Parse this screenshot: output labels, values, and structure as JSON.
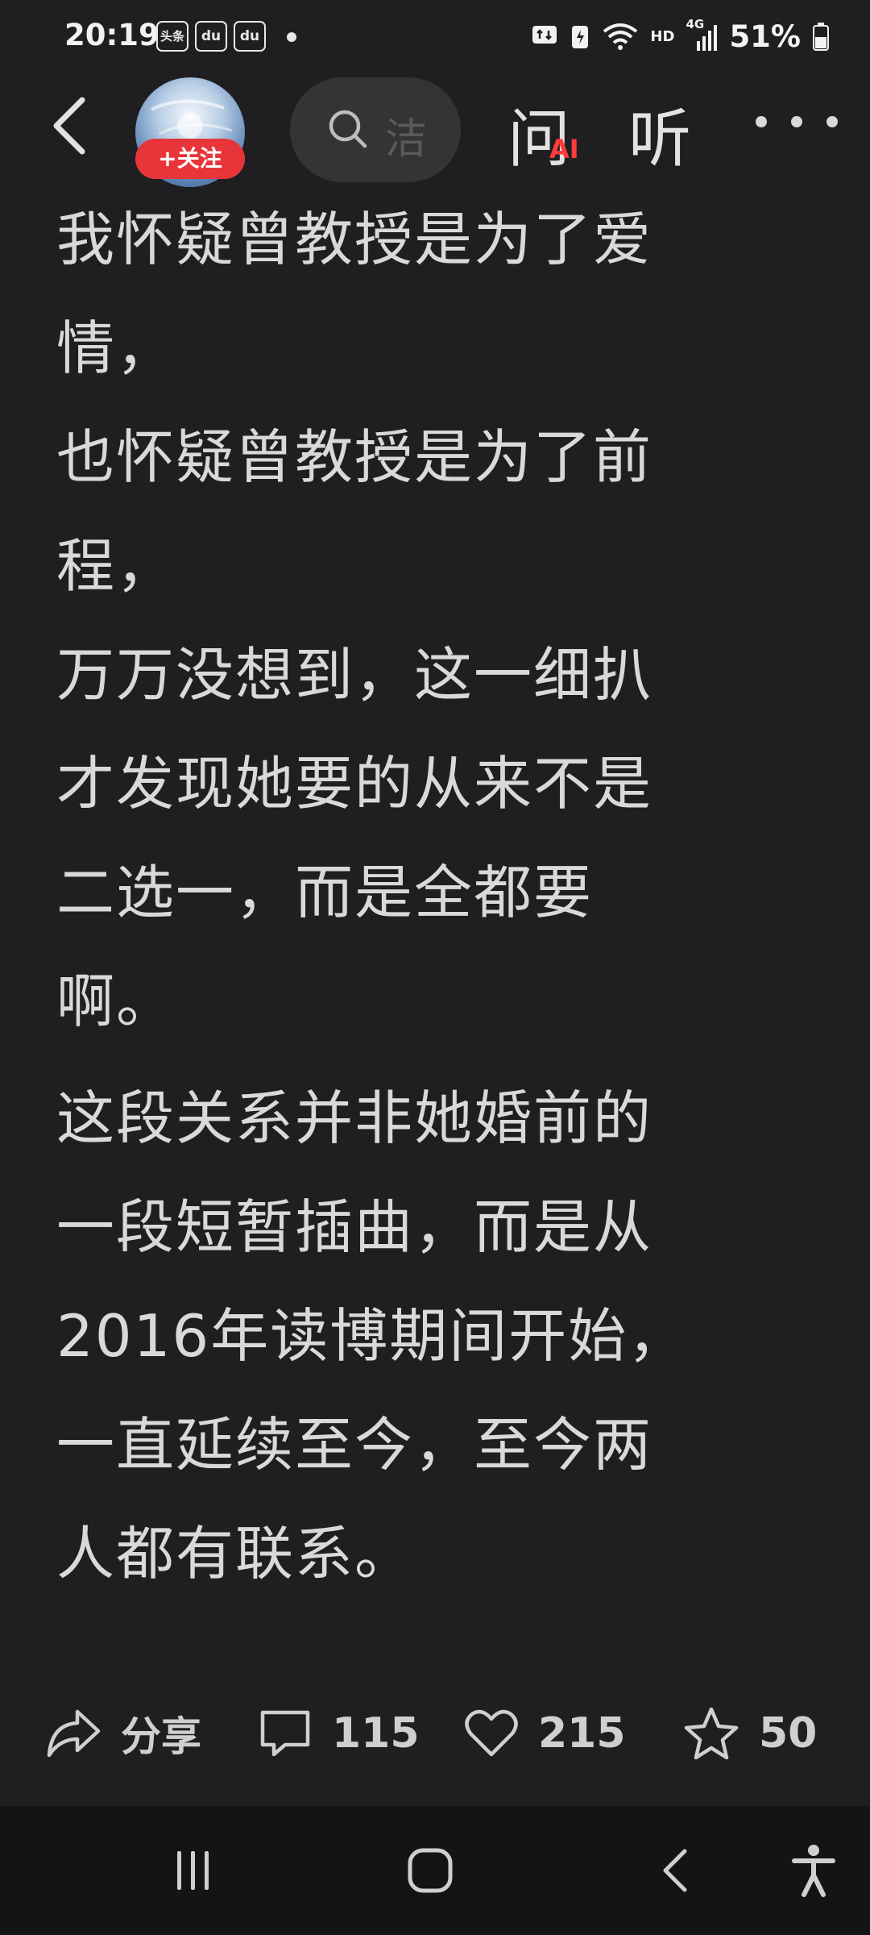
{
  "status_bar": {
    "time": "20:19",
    "app_icons": [
      "头条",
      "du",
      "du"
    ],
    "network": "HD",
    "signal": "4G",
    "battery": "51%"
  },
  "header": {
    "follow_label": "+关注",
    "search_placeholder": "洁",
    "ask_label": "问",
    "ai_badge": "AI",
    "listen_label": "听"
  },
  "article": {
    "paragraphs": [
      "我怀疑曾教授是为了爱\n情，\n也怀疑曾教授是为了前\n程，\n万万没想到，这一细扒\n才发现她要的从来不是\n二选一，而是全都要\n啊。",
      "这段关系并非她婚前的\n一段短暂插曲，而是从\n2016年读博期间开始，\n一直延续至今，至今两\n人都有联系。"
    ]
  },
  "actions": {
    "share_label": "分享",
    "comment_count": "115",
    "like_count": "215",
    "favorite_count": "50"
  },
  "colors": {
    "background": "#1f1f21",
    "text": "#d9d9d9",
    "follow_button": "#e8353a",
    "ai_badge": "#ff3b3b"
  }
}
